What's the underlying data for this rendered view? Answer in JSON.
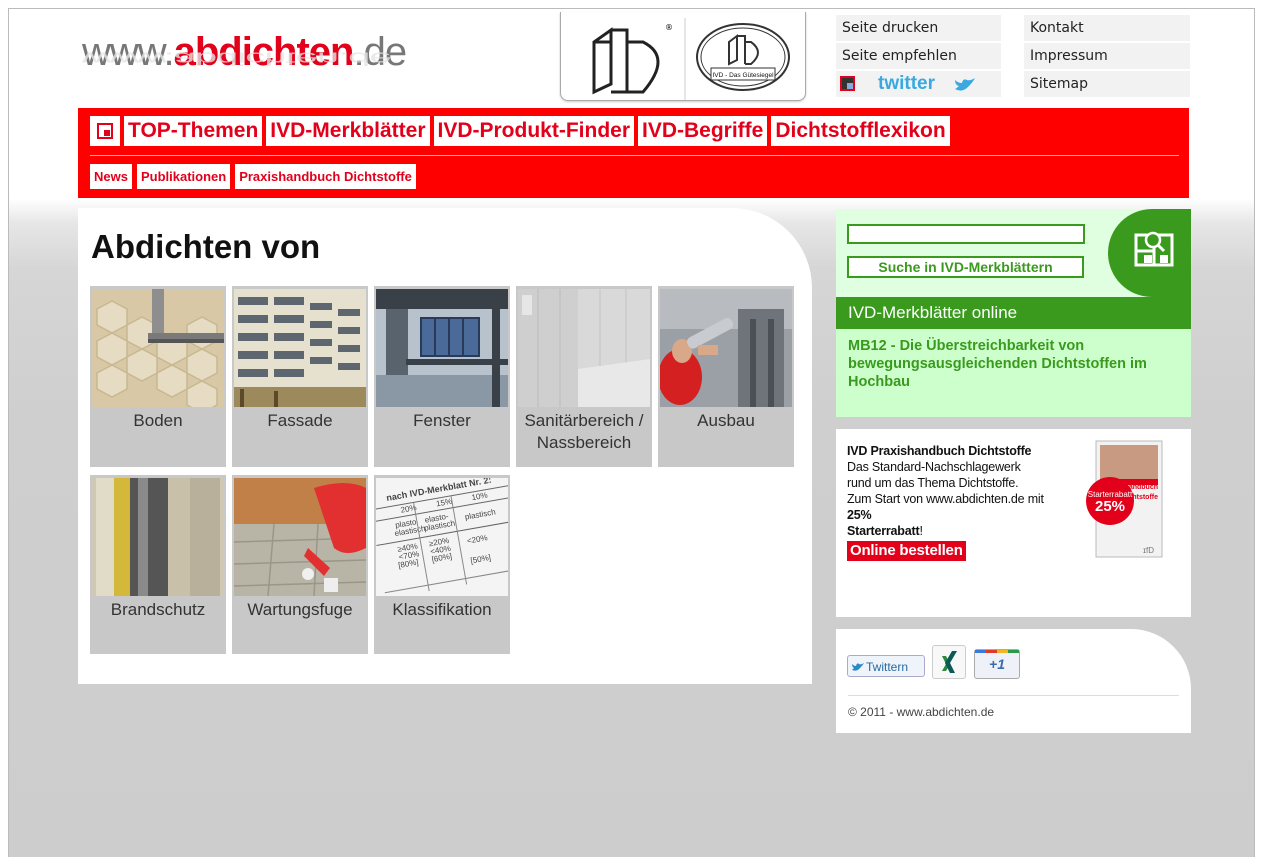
{
  "header": {
    "logo": {
      "prefix": "www.",
      "brand": "abdichten",
      "suffix": ".de"
    },
    "seal_text": "IVD - Das Gütesiegel",
    "top_links": [
      "Seite drucken",
      "Seite empfehlen",
      "Kontakt",
      "Impressum",
      "Sitemap"
    ],
    "twitter_text": "twitter"
  },
  "nav": {
    "primary": [
      "TOP-Themen",
      "IVD-Merkblätter",
      "IVD-Produkt-Finder",
      "IVD-Begriffe",
      "Dichtstofflexikon"
    ],
    "secondary": [
      "News",
      "Publikationen",
      "Praxishandbuch Dichtstoffe"
    ]
  },
  "main": {
    "title": "Abdichten von",
    "tiles": [
      {
        "label": "Boden"
      },
      {
        "label": "Fassade"
      },
      {
        "label": "Fenster"
      },
      {
        "label": "Sanitärbereich / Nassbereich"
      },
      {
        "label": "Ausbau"
      },
      {
        "label": "Brandschutz"
      },
      {
        "label": "Wartungsfuge"
      },
      {
        "label": "Klassifikation"
      }
    ],
    "klassifikation_img": {
      "heading": "nach IVD-Merkblatt Nr. 2:",
      "cols": [
        "20%",
        "15%",
        "10%"
      ]
    }
  },
  "search": {
    "button": "Suche in IVD-Merkblättern",
    "section_title": "IVD-Merkblätter online",
    "merkblatt": "MB12 - Die Überstreichbarkeit von bewegungsausgleichenden Dichtstoffen im Hochbau"
  },
  "book": {
    "title": "IVD Praxishandbuch Dichtstoffe",
    "desc1": "Das Standard-Nachschlagewerk rund um das Thema Dichtstoffe.",
    "desc2": "Zum Start von www.abdichten.de mit",
    "pct": "25%",
    "starter": "Starterrabatt",
    "excl": "!",
    "order": "Online bestellen",
    "badge_label": "Starterrabatt",
    "badge_value": "25%",
    "cover_title": "Praxishandbuch Dichtstoffe"
  },
  "social": {
    "twitter_button": "Twittern",
    "plusone": "+1",
    "copyright": "© 2011 - www.abdichten.de"
  },
  "colors": {
    "red": "#e2001a",
    "nav_red": "#ff0000",
    "green": "#3a9a1e",
    "light_green": "#ccffcc"
  }
}
